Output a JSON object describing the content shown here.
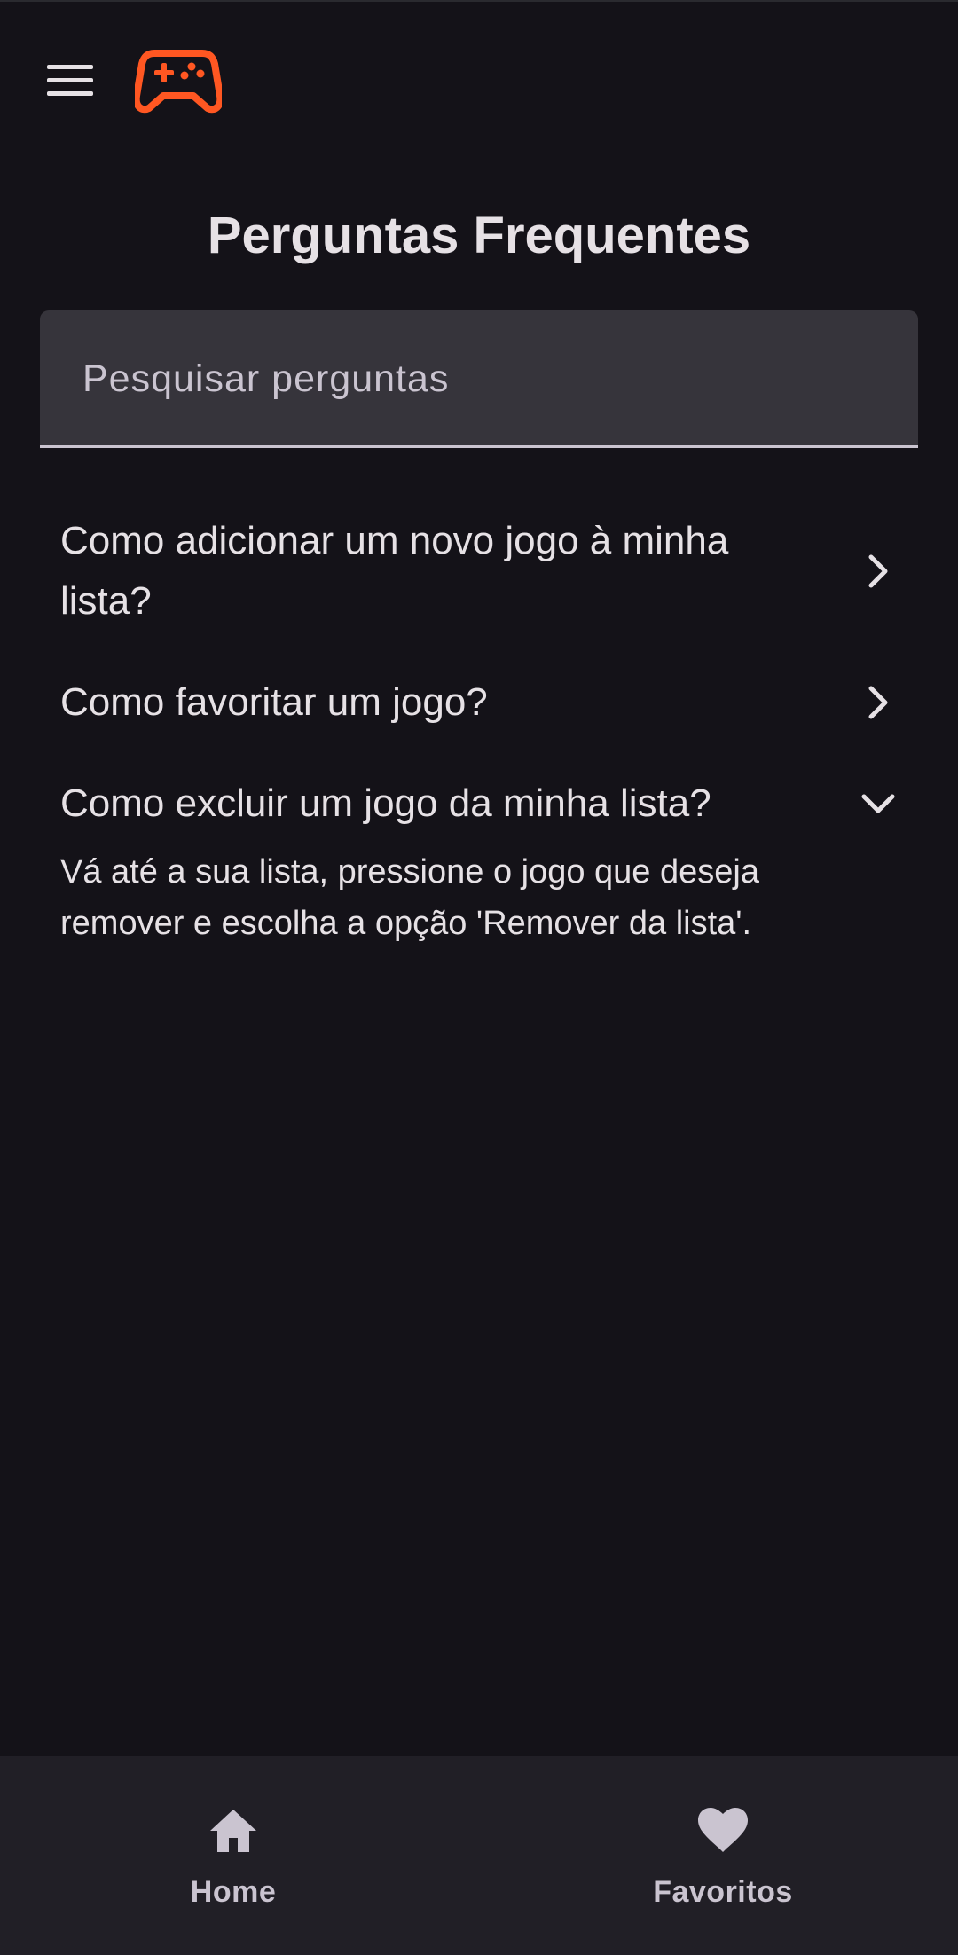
{
  "header": {
    "menu_icon": "hamburger-menu-icon",
    "logo_icon": "gamepad-icon",
    "logo_color": "#ff5722"
  },
  "page": {
    "title": "Perguntas Frequentes"
  },
  "search": {
    "placeholder": "Pesquisar perguntas",
    "value": ""
  },
  "faq": {
    "items": [
      {
        "question": "Como adicionar um novo jogo à minha lista?",
        "expanded": false,
        "icon": "chevron-right-icon"
      },
      {
        "question": "Como favoritar um jogo?",
        "expanded": false,
        "icon": "chevron-right-icon"
      },
      {
        "question": "Como excluir um jogo da minha lista?",
        "expanded": true,
        "icon": "chevron-down-icon",
        "answer": "Vá até a sua lista, pressione o jogo que deseja remover e escolha a opção 'Remover da lista'."
      }
    ]
  },
  "bottom_nav": {
    "items": [
      {
        "label": "Home",
        "icon": "home-icon"
      },
      {
        "label": "Favoritos",
        "icon": "heart-icon"
      }
    ]
  },
  "colors": {
    "background": "#141218",
    "surface": "#36343b",
    "nav_background": "#211f26",
    "text": "#e6e1e5",
    "text_muted": "#cac4d0",
    "accent": "#ff5722"
  }
}
